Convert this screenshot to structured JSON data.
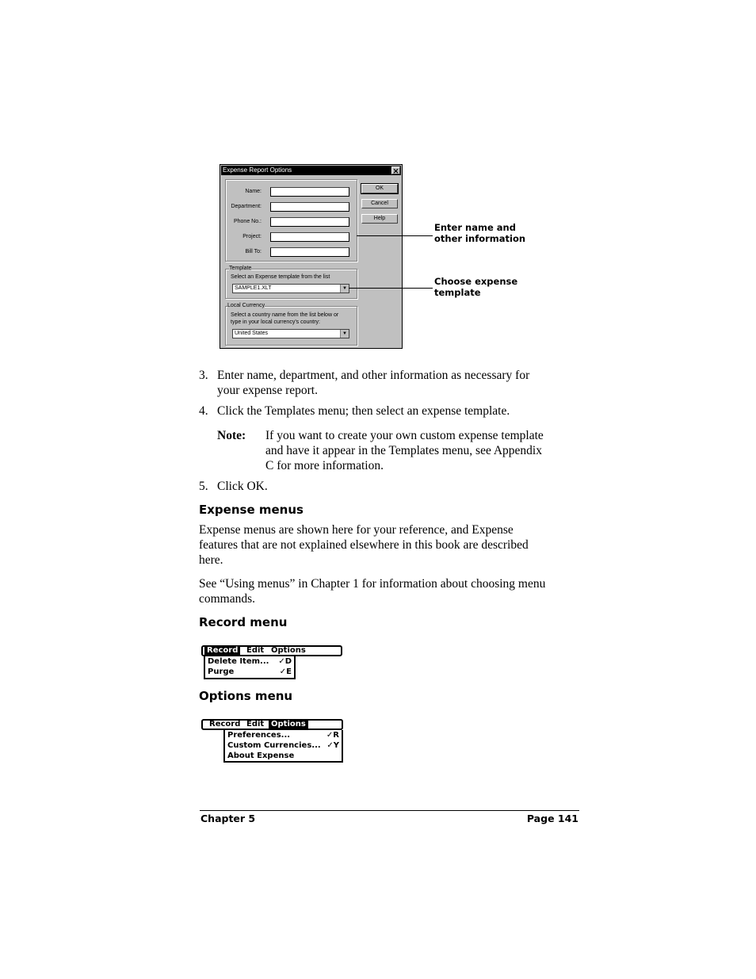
{
  "dialog": {
    "title": "Expense Report Options",
    "close_glyph": "✕",
    "fields": [
      {
        "label": "Name:",
        "value": ""
      },
      {
        "label": "Department:",
        "value": ""
      },
      {
        "label": "Phone No.:",
        "value": ""
      },
      {
        "label": "Project:",
        "value": ""
      },
      {
        "label": "Bill To:",
        "value": ""
      }
    ],
    "buttons": {
      "ok": "OK",
      "cancel": "Cancel",
      "help": "Help"
    },
    "template_group": {
      "title": "Template",
      "instruction": "Select an Expense template from the list",
      "selected": "SAMPLE1.XLT"
    },
    "currency_group": {
      "title": "Local Currency",
      "instruction_line1": "Select a country name from the list below or",
      "instruction_line2": "type in your local currency's country:",
      "selected": "United States"
    },
    "dropdown_glyph": "▼"
  },
  "callouts": {
    "first_line1": "Enter name and",
    "first_line2": "other information",
    "second_line1": "Choose expense",
    "second_line2": "template"
  },
  "steps": [
    {
      "num": "3.",
      "line1": "Enter name, department, and other information as necessary for",
      "line2": "your expense report."
    },
    {
      "num": "4.",
      "line1": "Click the Templates menu; then select an expense template."
    },
    {
      "num": "5.",
      "line1": "Click OK."
    }
  ],
  "note": {
    "label": "Note:",
    "line1": "If you want to create your own custom expense template",
    "line2": "and have it appear in the Templates menu, see Appendix",
    "line3": "C for more information."
  },
  "sections": {
    "expense_menus": {
      "heading": "Expense menus",
      "p1_line1": "Expense menus are shown here for your reference, and Expense",
      "p1_line2": "features that are not explained elsewhere in this book are described",
      "p1_line3": "here.",
      "p2_line1": "See “Using menus” in Chapter 1 for information about choosing menu",
      "p2_line2": "commands."
    },
    "record_menu": {
      "heading": "Record menu"
    },
    "options_menu": {
      "heading": "Options menu"
    }
  },
  "record_menu": {
    "bar": [
      "Record",
      "Edit",
      "Options"
    ],
    "items": [
      {
        "label": "Delete Item...",
        "shortcut": "✓D"
      },
      {
        "label": "Purge",
        "shortcut": "✓E"
      }
    ]
  },
  "options_menu": {
    "bar": [
      "Record",
      "Edit",
      "Options"
    ],
    "items": [
      {
        "label": "Preferences...",
        "shortcut": "✓R"
      },
      {
        "label": "Custom Currencies...",
        "shortcut": "✓Y"
      },
      {
        "label": "About Expense",
        "shortcut": ""
      }
    ]
  },
  "footer": {
    "left": "Chapter 5",
    "right": "Page 141"
  }
}
